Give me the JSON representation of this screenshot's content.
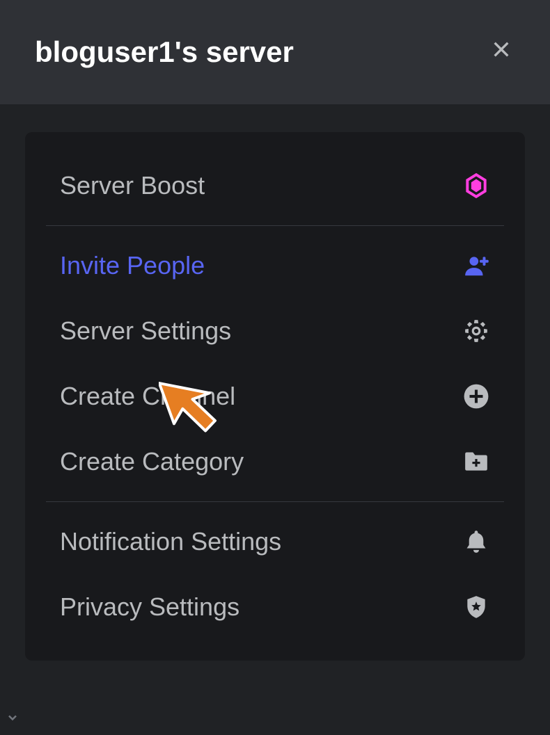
{
  "header": {
    "title": "bloguser1's server"
  },
  "menu": {
    "server_boost": "Server Boost",
    "invite_people": "Invite People",
    "server_settings": "Server Settings",
    "create_channel": "Create Channel",
    "create_category": "Create Category",
    "notification_settings": "Notification Settings",
    "privacy_settings": "Privacy Settings"
  }
}
